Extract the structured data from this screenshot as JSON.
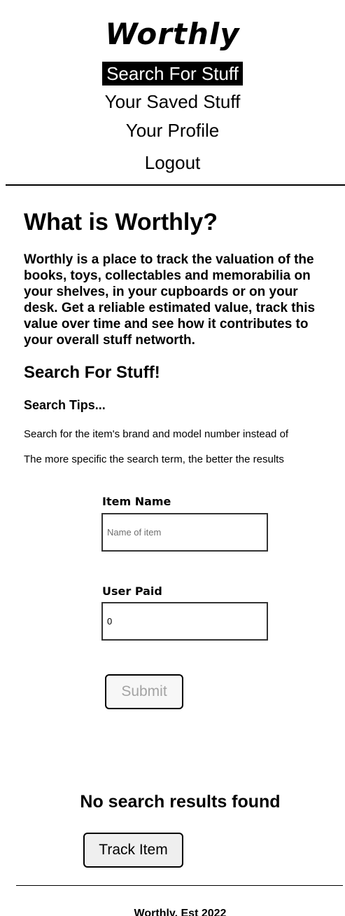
{
  "header": {
    "brand": "Worthly",
    "nav": [
      {
        "label": "Search For Stuff",
        "active": true
      },
      {
        "label": "Your Saved Stuff",
        "active": false
      },
      {
        "label": "Your Profile",
        "active": false
      },
      {
        "label": "Logout",
        "active": false
      }
    ]
  },
  "main": {
    "heading": "What is Worthly?",
    "intro": "Worthly is a place to track the valuation of the books, toys, collectables and memorabilia on your shelves, in your cupboards or on your desk. Get a reliable estimated value, track this value over time and see how it contributes to your overall stuff networth.",
    "search_heading": "Search For Stuff!",
    "tips_heading": "Search Tips...",
    "tips": [
      "Search for the item's brand and model number instead of",
      "The more specific the search term, the better the results"
    ]
  },
  "form": {
    "item_name_label": "Item Name",
    "item_name_placeholder": "Name of item",
    "item_name_value": "",
    "user_paid_label": "User Paid",
    "user_paid_value": "0",
    "submit_label": "Submit"
  },
  "results": {
    "empty_message": "No search results found",
    "track_label": "Track Item"
  },
  "footer": {
    "text": "Worthly, Est 2022"
  }
}
